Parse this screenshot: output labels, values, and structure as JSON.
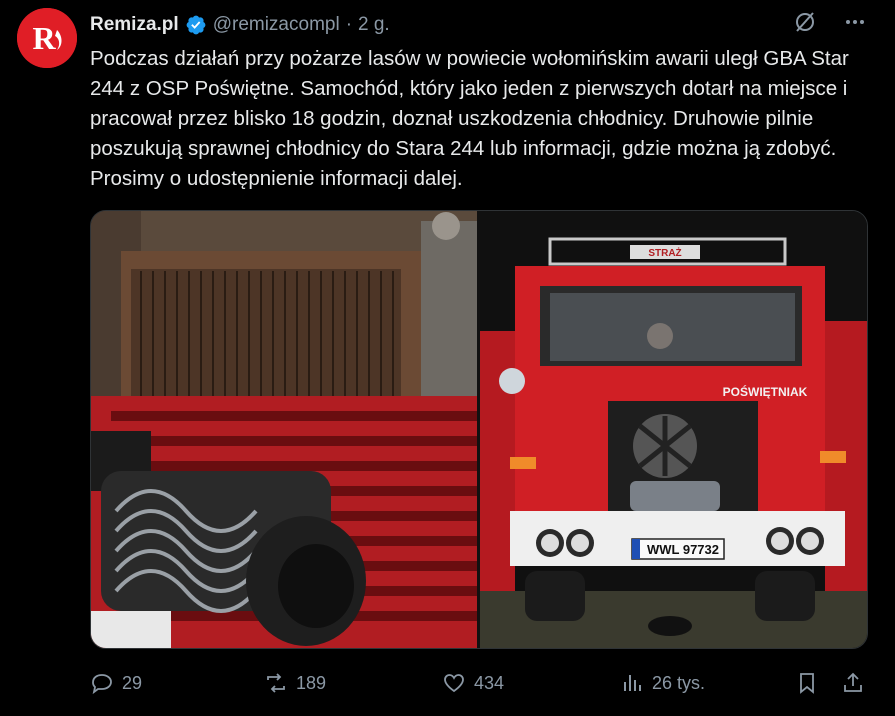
{
  "author": {
    "name": "Remiza.pl",
    "handle": "@remizacompl",
    "separator": "·",
    "time": "2 g.",
    "avatar_letters": "R"
  },
  "post": {
    "text": "Podczas działań przy pożarze lasów w powiecie wołomińskim awarii uległ GBA Star 244 z OSP Poświętne. Samochód, który jako jeden z pierwszych dotarł na miejsce i pracował przez blisko 18 godzin, doznał uszkodzenia chłodnicy. Druhowie pilnie poszukują sprawnej chłodnicy do Stara 244 lub informacji, gdzie można ją zdobyć. Prosimy o udostępnienie informacji dalej."
  },
  "media": {
    "left_photo_icon": "radiator-winch-photo",
    "right_photo_icon": "fire-truck-photo",
    "truck_roof_text": "STRAŻ",
    "truck_front_text": "POŚWIĘTNIAK",
    "plate_text": "WWL 97732"
  },
  "actions": {
    "replies": "29",
    "reposts": "189",
    "likes": "434",
    "views": "26 tys."
  },
  "colors": {
    "background": "#000000",
    "text": "#e7e9ea",
    "muted": "#8b98a5",
    "verified": "#1d9bf0",
    "avatar": "#e01e26"
  }
}
